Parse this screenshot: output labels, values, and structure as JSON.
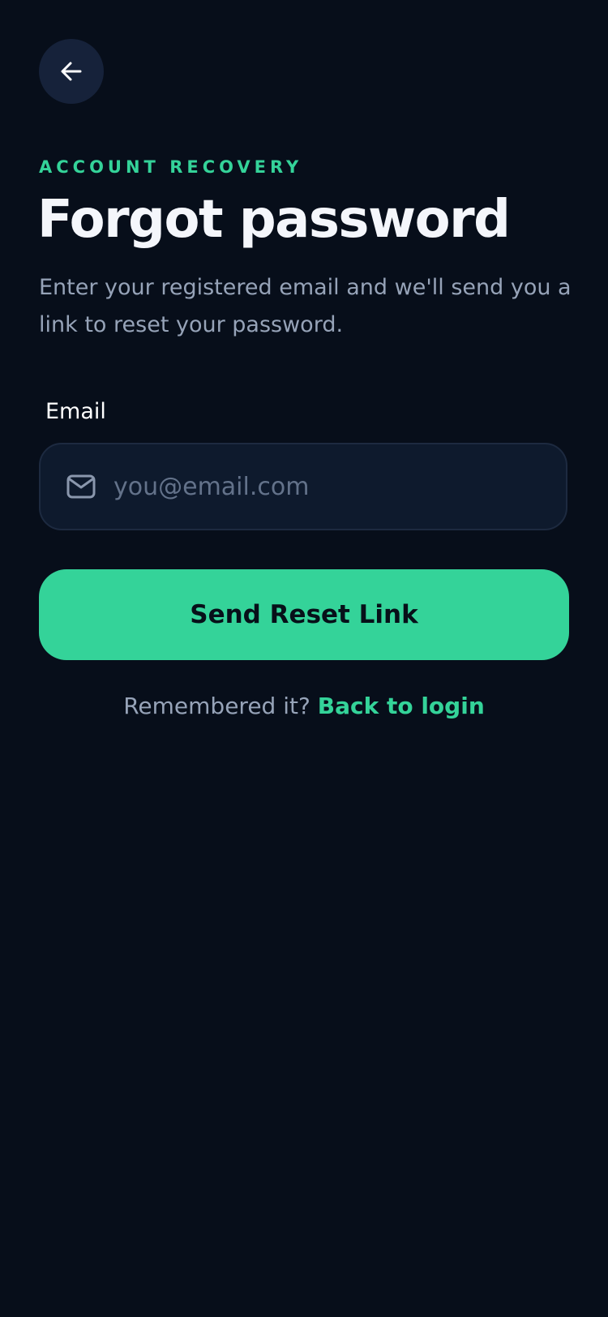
{
  "header": {
    "back_icon": "arrow-left-icon"
  },
  "intro": {
    "eyebrow": "ACCOUNT RECOVERY",
    "title": "Forgot password",
    "subtitle": "Enter your registered email and we'll send you a link to reset your password."
  },
  "form": {
    "email_label": "Email",
    "email_icon": "mail-icon",
    "email_value": "",
    "email_placeholder": "you@email.com",
    "submit_label": "Send Reset Link"
  },
  "footer": {
    "prompt": "Remembered it?",
    "link_label": "Back to login"
  },
  "colors": {
    "background": "#070e1a",
    "accent": "#34d399",
    "input_background": "#0e1a2d",
    "back_button_background": "#16223a"
  }
}
